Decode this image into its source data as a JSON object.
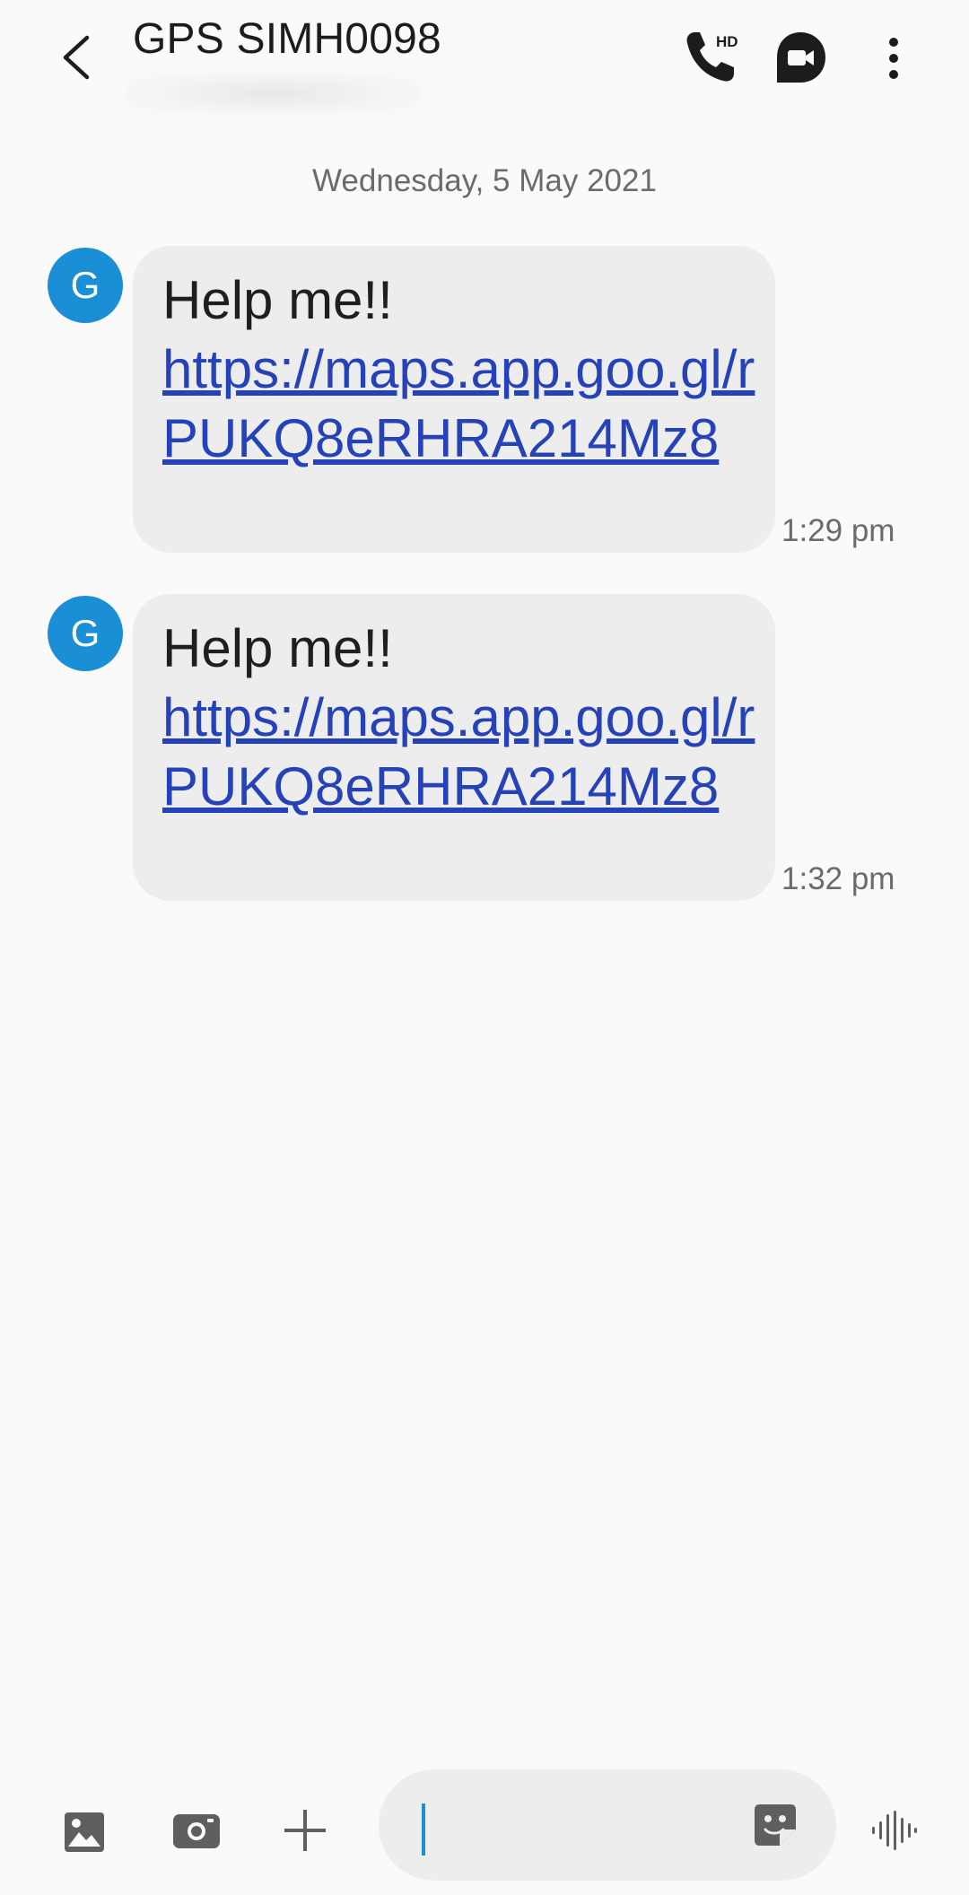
{
  "header": {
    "contact_name": "GPS SIMH0098",
    "icons": {
      "back": "back-arrow-icon",
      "call": "hd-voice-call-icon",
      "video": "video-call-icon",
      "more": "more-vertical-icon"
    },
    "call_badge": "HD"
  },
  "conversation": {
    "date": "Wednesday, 5 May 2021",
    "messages": [
      {
        "avatar_letter": "G",
        "text": "Help me!!",
        "link": "https://maps.app.goo.gl/rPUKQ8eRHRA214Mz8",
        "time": "1:29 pm"
      },
      {
        "avatar_letter": "G",
        "text": "Help me!!",
        "link": "https://maps.app.goo.gl/rPUKQ8eRHRA214Mz8",
        "time": "1:32 pm"
      }
    ]
  },
  "composer": {
    "input_value": "",
    "placeholder": "",
    "icons": {
      "gallery": "image-gallery-icon",
      "camera": "camera-icon",
      "add": "plus-icon",
      "sticker": "sticker-icon",
      "voice": "voice-waveform-icon"
    }
  },
  "colors": {
    "background": "#fafafa",
    "bubble": "#ededed",
    "avatar": "#1a8fd6",
    "link": "#2542b8",
    "meta_text": "#6b6b6b",
    "cursor": "#1a8fd6"
  }
}
